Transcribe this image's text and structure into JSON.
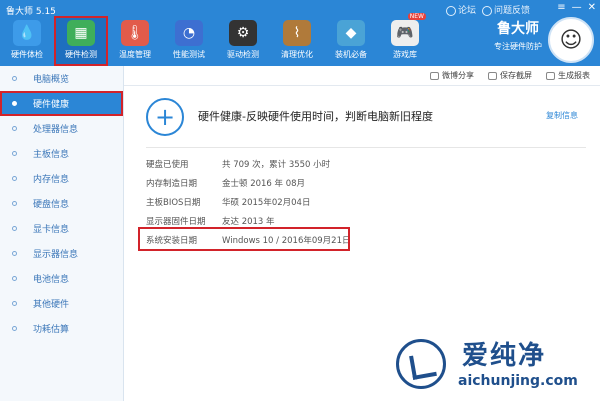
{
  "app": {
    "title": "鲁大师 5.15"
  },
  "window_links": [
    "论坛",
    "问题反馈"
  ],
  "toolbar": [
    {
      "label": "硬件体检",
      "icon": "drop-icon",
      "color": "#3d9be9"
    },
    {
      "label": "硬件检测",
      "icon": "board-icon",
      "color": "#3fae5a",
      "active": true
    },
    {
      "label": "温度管理",
      "icon": "thermometer-icon",
      "color": "#e25b4a"
    },
    {
      "label": "性能测试",
      "icon": "gauge-icon",
      "color": "#3d6fd1"
    },
    {
      "label": "驱动检测",
      "icon": "gear-icon",
      "color": "#333333"
    },
    {
      "label": "清理优化",
      "icon": "broom-icon",
      "color": "#b07a3a"
    },
    {
      "label": "装机必备",
      "icon": "cube-icon",
      "color": "#4aa3d6"
    },
    {
      "label": "游戏库",
      "icon": "gamepad-icon",
      "color": "#eeeeee",
      "badge": "NEW"
    }
  ],
  "brand": {
    "name": "鲁大师",
    "subtitle": "专注硬件防护"
  },
  "sidebar": {
    "items": [
      {
        "label": "电脑概览"
      },
      {
        "label": "硬件健康",
        "active": true
      },
      {
        "label": "处理器信息"
      },
      {
        "label": "主板信息"
      },
      {
        "label": "内存信息"
      },
      {
        "label": "硬盘信息"
      },
      {
        "label": "显卡信息"
      },
      {
        "label": "显示器信息"
      },
      {
        "label": "电池信息"
      },
      {
        "label": "其他硬件"
      },
      {
        "label": "功耗估算"
      }
    ]
  },
  "subbar": {
    "share": "微博分享",
    "screenshot": "保存截屏",
    "report": "生成报表"
  },
  "main": {
    "title": "硬件健康-反映硬件使用时间，判断电脑新旧程度",
    "copy": "复制信息",
    "rows": [
      {
        "key": "硬盘已使用",
        "value": "共 709 次，累计 3550 小时"
      },
      {
        "key": "内存制造日期",
        "value": "金士顿 2016 年 08月"
      },
      {
        "key": "主板BIOS日期",
        "value": "华硕 2015年02月04日"
      },
      {
        "key": "显示器固件日期",
        "value": "友达 2013 年"
      },
      {
        "key": "系统安装日期",
        "value": "Windows 10 / 2016年09月21日"
      }
    ]
  },
  "watermark": {
    "cn": "爱纯净",
    "url": "aichunjing.com"
  }
}
